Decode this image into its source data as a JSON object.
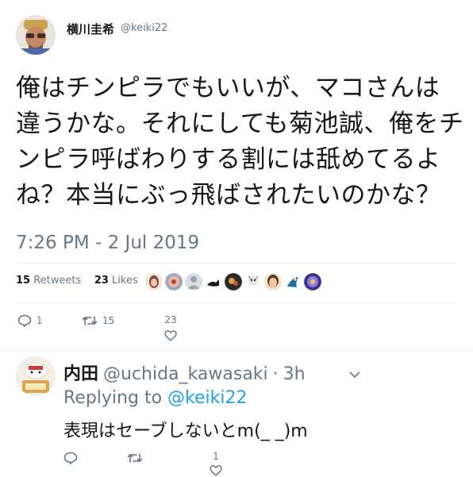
{
  "tweet": {
    "author_name": "横川圭希",
    "author_handle": "@keiki22",
    "text": "俺はチンピラでもいいが、マコさんは違うかな。それにしても菊池誠、俺をチンピラ呼ばわりする割には舐めてるよね？本当にぶっ飛ばされたいのかな？",
    "timestamp": "7:26 PM - 2 Jul 2019",
    "retweets_count": "15",
    "retweets_label": "Retweets",
    "likes_count": "23",
    "likes_label": "Likes",
    "actions": {
      "reply_count": "1",
      "retweet_count": "15",
      "like_count": "23"
    }
  },
  "reply": {
    "name": "内田",
    "handle": "@uchida_kawasaki",
    "separator": "·",
    "time": "3h",
    "replying_to_label": "Replying to",
    "replying_to_handle": "@keiki22",
    "text": "表現はセーブしないとm(_ _)m",
    "actions": {
      "like_count": "1"
    }
  },
  "colors": {
    "text": "#14171a",
    "secondary": "#657786",
    "link": "#1da1f2",
    "divider": "#e6ecf0"
  },
  "icons": [
    "reply-icon",
    "retweet-icon",
    "heart-icon",
    "chevron-down-icon"
  ]
}
